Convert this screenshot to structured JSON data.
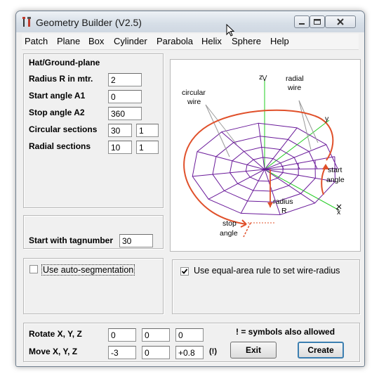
{
  "window": {
    "title": "Geometry Builder (V2.5)"
  },
  "menu": [
    "Patch",
    "Plane",
    "Box",
    "Cylinder",
    "Parabola",
    "Helix",
    "Sphere",
    "Help"
  ],
  "hat_panel": {
    "heading": "Hat/Ground-plane",
    "radius_label": "Radius R in mtr.",
    "radius_value": "2",
    "start_angle_label": "Start angle A1",
    "start_angle_value": "0",
    "stop_angle_label": "Stop angle A2",
    "stop_angle_value": "360",
    "circular_label": "Circular sections",
    "circular_value_1": "30",
    "circular_value_2": "1",
    "radial_label": "Radial sections",
    "radial_value_1": "10",
    "radial_value_2": "1"
  },
  "tag_panel": {
    "label": "Start with tagnumber",
    "value": "30"
  },
  "auto_seg": {
    "label": "Use auto-segmentation",
    "checked": false
  },
  "equal_area": {
    "label": "Use equal-area rule to set wire-radius",
    "checked": true
  },
  "diagram": {
    "z_label": "z",
    "y_label": "y",
    "x_label": "x",
    "radial_wire_1": "radial",
    "radial_wire_2": "wire",
    "circular_wire_1": "circular",
    "circular_wire_2": "wire",
    "start_angle_1": "start",
    "start_angle_2": "angle",
    "radius_1": "radius",
    "radius_2": "R",
    "stop_angle_1": "stop",
    "stop_angle_2": "angle"
  },
  "bottom": {
    "rotate_label": "Rotate X, Y, Z",
    "rotate_x": "0",
    "rotate_y": "0",
    "rotate_z": "0",
    "move_label": "Move X, Y, Z",
    "move_x": "-3",
    "move_y": "0",
    "move_z": "+0.8",
    "move_note": "(!)",
    "symbols_note": "! =  symbols also allowed",
    "exit_label": "Exit",
    "create_label": "Create"
  },
  "colors": {
    "accent_red": "#e0502a",
    "wire_purple": "#6a1a9a",
    "axis_green": "#22cc22"
  }
}
